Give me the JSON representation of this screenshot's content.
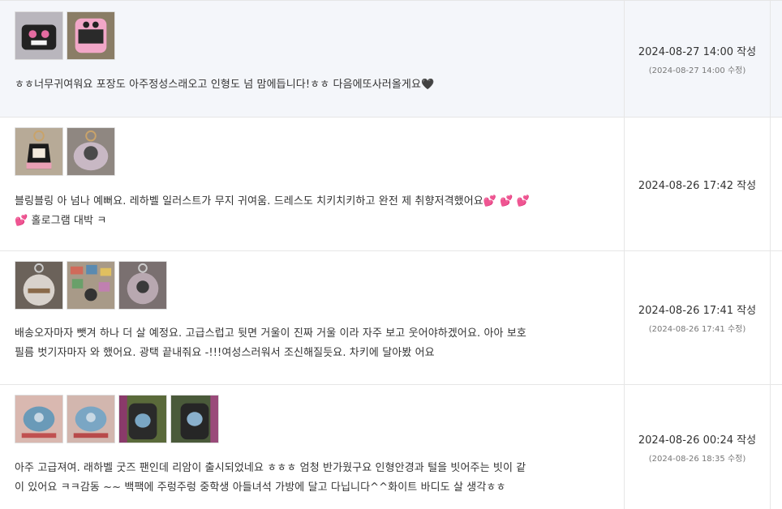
{
  "reviews": [
    {
      "text": "ㅎㅎ너무귀여워요 포장도 아주정성스래오고 인형도 넘 맘에듭니다!ㅎㅎ 다음에또사러올게요🖤",
      "date": "2024-08-27 14:00 작성",
      "edited": "(2024-08-27 14:00 수정)",
      "thumbs": [
        "photo-thumbnail",
        "photo-thumbnail"
      ]
    },
    {
      "text": "블링블링 아 넘나 예뻐요. 레하벨 일러스트가 무지 귀여움. 드레스도 치키치키하고 완전 제 취향저격했어요💕 💕 💕\n💕 홀로그램 대박 ㅋ",
      "date": "2024-08-26 17:42 작성",
      "edited": "",
      "thumbs": [
        "photo-thumbnail",
        "photo-thumbnail"
      ]
    },
    {
      "text": "배송오자마자 뺏겨 하나 더 살 예정요. 고급스럽고 뒷면 거울이 진짜 거울 이라 자주 보고 웃어야하겠어요. 아아 보호\n필름 벗기자마자 와 했어요. 광택 끝내줘요 -!!!여성스러워서 조신해질듯요. 차키에 달아봤 어요",
      "date": "2024-08-26 17:41 작성",
      "edited": "(2024-08-26 17:41 수정)",
      "thumbs": [
        "photo-thumbnail",
        "photo-thumbnail",
        "photo-thumbnail"
      ]
    },
    {
      "text": "아주 고급져여. 래하벨 굿즈 팬인데 리암이 출시되었네요 ㅎㅎㅎ 엄청 반가웠구요 인형안경과 털을 빗어주는 빗이 같\n이 있어요 ㅋㅋ감동 ~~ 백팩에 주렁주렁 중학생 아들녀석 가방에 달고 다닙니다^^화이트 바디도 살 생각ㅎㅎ",
      "date": "2024-08-26 00:24 작성",
      "edited": "(2024-08-26 18:35 수정)",
      "thumbs": [
        "photo-thumbnail",
        "photo-thumbnail",
        "photo-thumbnail",
        "photo-thumbnail"
      ]
    }
  ],
  "colors": {
    "highlight_row": "#f4f6fa",
    "border": "#e6e6e6",
    "text": "#333333",
    "muted": "#777777"
  }
}
